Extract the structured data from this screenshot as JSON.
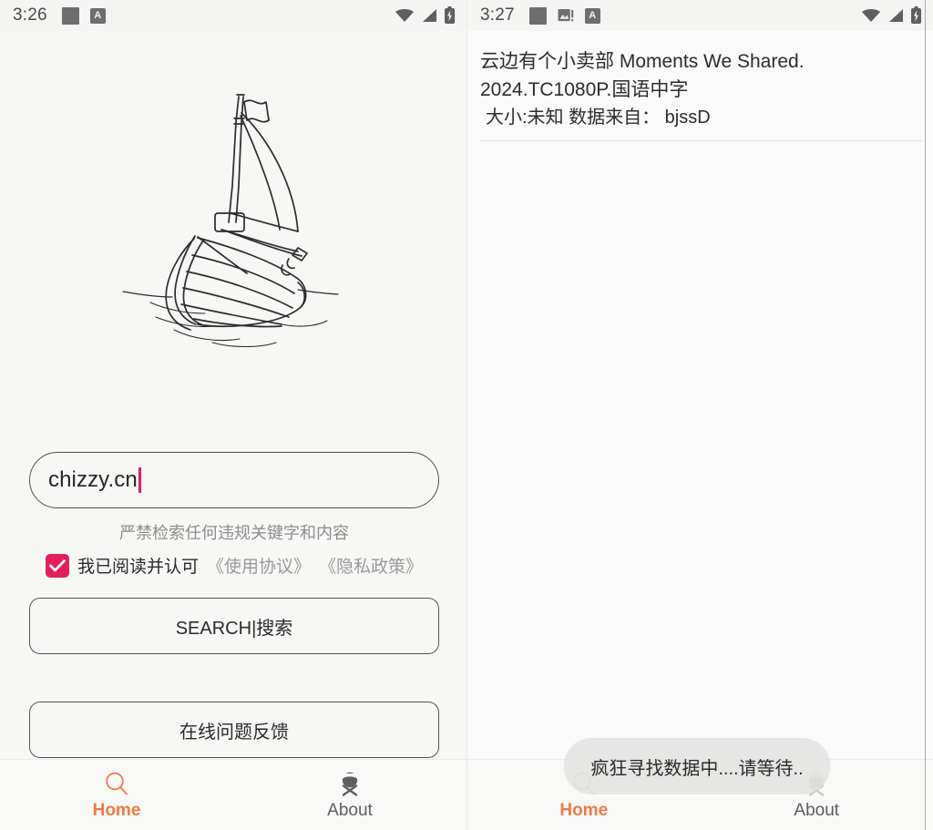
{
  "app": {
    "accent_orange": "#ef7b45",
    "accent_pink": "#e3205e",
    "background": "#f7f7f5"
  },
  "left_panel": {
    "statusbar": {
      "clock": "3:26",
      "left_icons": [
        "app-square-icon",
        "a-badge-icon"
      ],
      "right_icons": [
        "wifi-icon",
        "signal-icon",
        "battery-charging-icon"
      ],
      "battery_badge": "A"
    },
    "illustration": {
      "name": "sailboat-sketch-illustration"
    },
    "search": {
      "value": "chizzy.cn",
      "placeholder": "",
      "warning": "严禁检索任何违规关键字和内容"
    },
    "agreement": {
      "checked": true,
      "label": "我已阅读并认可",
      "link_terms": "《使用协议》",
      "link_privacy": "《隐私政策》"
    },
    "buttons": {
      "search_label": "SEARCH|搜索",
      "feedback_label": "在线问题反馈"
    },
    "bottomnav": {
      "items": [
        {
          "label": "Home",
          "icon": "search-icon",
          "active": true
        },
        {
          "label": "About",
          "icon": "about-person-icon",
          "active": false
        }
      ]
    }
  },
  "right_panel": {
    "statusbar": {
      "clock": "3:27",
      "left_icons": [
        "app-square-icon",
        "photo-alert-icon",
        "a-badge-icon"
      ],
      "right_icons": [
        "wifi-icon",
        "signal-icon",
        "battery-charging-icon"
      ],
      "battery_badge": "A"
    },
    "results": [
      {
        "title": "云边有个小卖部 Moments We Shared. 2024.TC1080P.国语中字",
        "meta": " 大小:未知  数据来自： bjssD"
      }
    ],
    "toast": {
      "message": "疯狂寻找数据中....请等待.."
    },
    "bottomnav": {
      "items": [
        {
          "label": "Home",
          "icon": "search-icon",
          "active": true
        },
        {
          "label": "About",
          "icon": "about-person-icon",
          "active": false
        }
      ]
    }
  }
}
